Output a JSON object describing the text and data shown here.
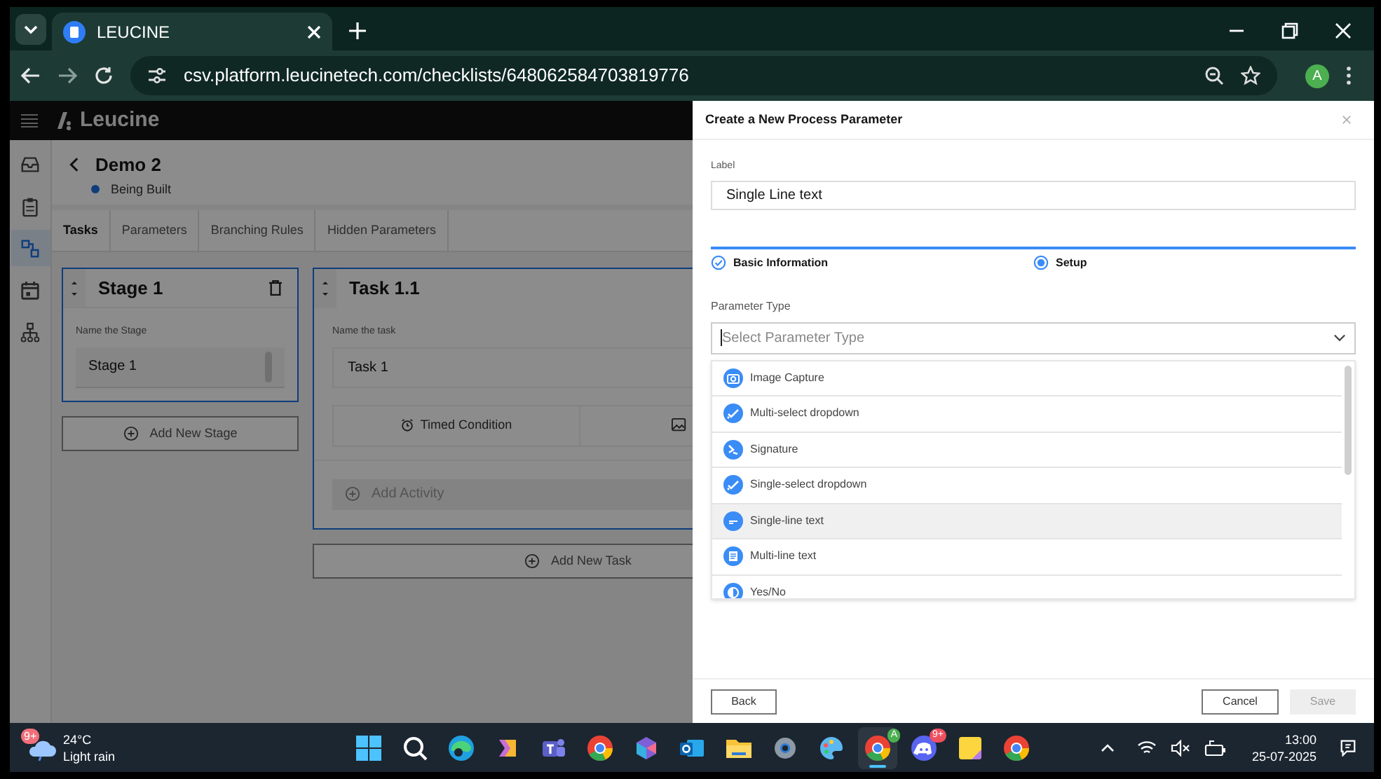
{
  "browser": {
    "tab_title": "LEUCINE",
    "url": "csv.platform.leucinetech.com/checklists/648062584703819776",
    "profile_initial": "A"
  },
  "app": {
    "brand": "Leucine",
    "nav_items": [
      {
        "kind": "inbox",
        "selected": false
      },
      {
        "kind": "clipboard",
        "selected": false
      },
      {
        "kind": "flow",
        "selected": true
      },
      {
        "kind": "calendar",
        "selected": false
      },
      {
        "kind": "hierarchy",
        "selected": false
      }
    ],
    "checklist": {
      "title": "Demo 2",
      "status": "Being Built"
    },
    "tabs": [
      {
        "label": "Tasks",
        "selected": true
      },
      {
        "label": "Parameters",
        "selected": false
      },
      {
        "label": "Branching Rules",
        "selected": false
      },
      {
        "label": "Hidden Parameters",
        "selected": false
      }
    ],
    "stage": {
      "title": "Stage 1",
      "name_caption": "Name the Stage",
      "name_value": "Stage 1"
    },
    "add_stage": "Add New Stage",
    "task": {
      "title": "Task 1.1",
      "name_caption": "Name the task",
      "name_value": "Task 1",
      "timed_condition": "Timed Condition",
      "add_activity": "Add Activity"
    },
    "add_task": "Add New Task"
  },
  "drawer": {
    "title": "Create a New Process Parameter",
    "label_caption": "Label",
    "label_value": "Single Line text",
    "steps": [
      {
        "label": "Basic Information",
        "kind": "done"
      },
      {
        "label": "Setup",
        "kind": "current"
      }
    ],
    "type_caption": "Parameter Type",
    "type_placeholder": "Select Parameter Type",
    "options": [
      {
        "label": "Image Capture",
        "kind": "camera",
        "selected": false
      },
      {
        "label": "Multi-select dropdown",
        "kind": "check",
        "selected": false
      },
      {
        "label": "Signature",
        "kind": "signature",
        "selected": false
      },
      {
        "label": "Single-select dropdown",
        "kind": "check",
        "selected": false
      },
      {
        "label": "Single-line text",
        "kind": "line",
        "selected": true
      },
      {
        "label": "Multi-line text",
        "kind": "lines",
        "selected": false
      },
      {
        "label": "Yes/No",
        "kind": "yesno",
        "selected": false
      }
    ],
    "buttons": [
      {
        "label": "Back",
        "kind": "back",
        "disabled": false
      },
      {
        "label": "Cancel",
        "kind": "cancel",
        "disabled": false
      },
      {
        "label": "Save",
        "kind": "save",
        "disabled": true
      }
    ]
  },
  "taskbar": {
    "weather": {
      "badge": "9+",
      "temperature": "24°C",
      "condition": "Light rain"
    },
    "apps": [
      {
        "kind": "start",
        "selected": false
      },
      {
        "kind": "search",
        "selected": false
      },
      {
        "kind": "edge",
        "selected": false
      },
      {
        "kind": "copilot",
        "selected": false
      },
      {
        "kind": "teams",
        "selected": false
      },
      {
        "kind": "chrome",
        "selected": false
      },
      {
        "kind": "m365",
        "selected": false
      },
      {
        "kind": "outlook",
        "selected": false
      },
      {
        "kind": "folder",
        "selected": false
      },
      {
        "kind": "settings",
        "selected": false
      },
      {
        "kind": "paint",
        "selected": false
      },
      {
        "kind": "chrome",
        "selected": true,
        "badge": "A"
      },
      {
        "kind": "discord",
        "selected": false,
        "badge": "9+"
      },
      {
        "kind": "notes",
        "selected": false
      },
      {
        "kind": "chrome",
        "selected": false
      }
    ],
    "time": "13:00",
    "date": "25-07-2025"
  }
}
